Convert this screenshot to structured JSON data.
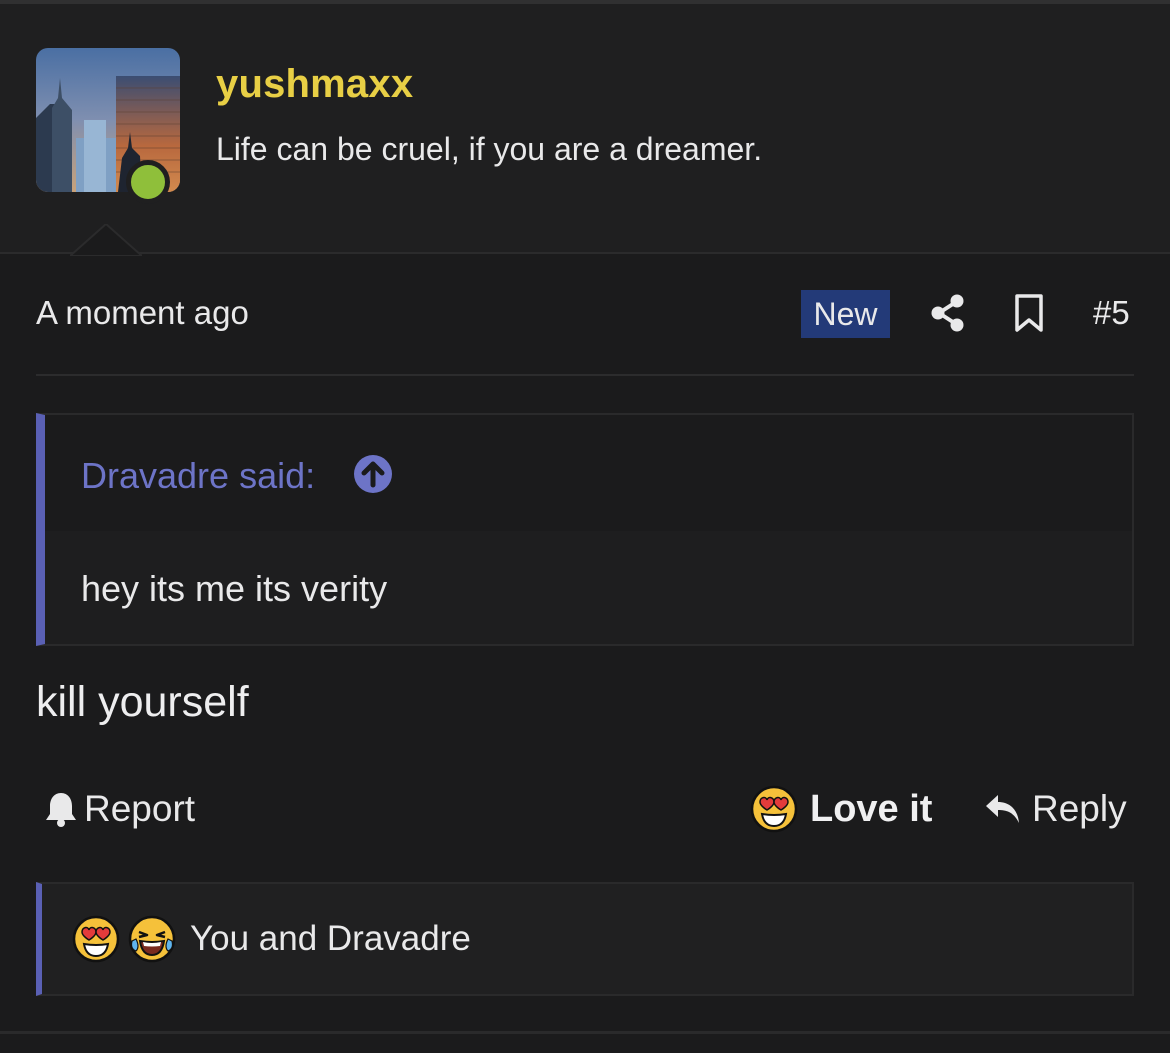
{
  "post": {
    "author": {
      "username": "yushmaxx",
      "user_title": "Life can be cruel, if you are a dreamer.",
      "online": true
    },
    "time": "A moment ago",
    "new_badge": "New",
    "post_number": "#5",
    "quote": {
      "author_line": "Dravadre said:",
      "text": "hey its me its verity"
    },
    "message": "kill yourself",
    "actions": {
      "report_label": "Report",
      "reaction_label": "Love it",
      "reply_label": "Reply"
    },
    "reactions_summary": "You and Dravadre",
    "reaction_icons": [
      "heart-eyes-emoji",
      "laughing-crying-emoji"
    ]
  },
  "colors": {
    "background": "#1b1b1c",
    "username": "#e8cf45",
    "accent": "#5a60b4",
    "quote_author": "#6d74c7",
    "new_badge": "#233a78",
    "online": "#8fbf3a"
  }
}
